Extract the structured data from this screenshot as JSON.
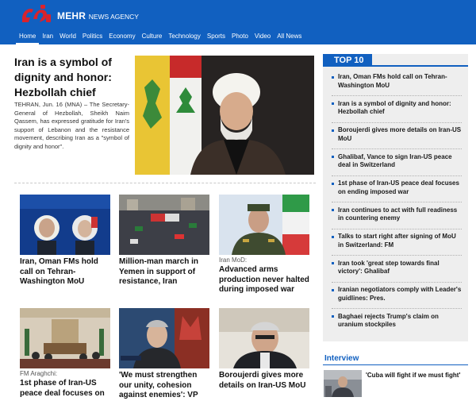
{
  "header": {
    "brand": "MEHR",
    "brand_sub": "NEWS AGENCY",
    "nav": [
      "Home",
      "Iran",
      "World",
      "Politics",
      "Economy",
      "Culture",
      "Technology",
      "Sports",
      "Photo",
      "Video",
      "All News"
    ],
    "active_nav": "Home"
  },
  "colors": {
    "brand_blue": "#1160c0",
    "logo_red": "#d9232d"
  },
  "lead": {
    "title": "Iran is a symbol of dignity and honor: Hezbollah chief",
    "text": "TEHRAN, Jun. 16 (MNA) – The Secretary-General of Hezbollah, Sheikh Naim Qassem, has expressed gratitude for Iran's support of Lebanon and the resistance movement, describing Iran as a \"symbol of dignity and honor\"."
  },
  "cards": [
    {
      "kicker": "",
      "title": "Iran, Oman FMs hold call on Tehran-Washington MoU"
    },
    {
      "kicker": "",
      "title": "Million-man march in Yemen in support of resistance, Iran"
    },
    {
      "kicker": "Iran MoD:",
      "title": "Advanced arms production never halted during imposed war"
    },
    {
      "kicker": "FM Araghchi:",
      "title": "1st phase of Iran-US peace deal focuses on"
    },
    {
      "kicker": "",
      "title": "'We must strengthen our unity, cohesion against enemies': VP"
    },
    {
      "kicker": "",
      "title": "Boroujerdi gives more details on Iran-US MoU"
    }
  ],
  "sidebar": {
    "top10_label": "TOP 10",
    "top10": [
      "Iran, Oman FMs hold call on Tehran-Washington MoU",
      "Iran is a symbol of dignity and honor: Hezbollah chief",
      "Boroujerdi gives more details on Iran-US MoU",
      "Ghalibaf, Vance to sign Iran-US peace deal in Switzerland",
      "1st phase of Iran-US peace deal focuses on ending imposed war",
      "Iran continues to act with full readiness in countering enemy",
      "Talks to start right after signing of MoU in Switzerland: FM",
      "Iran took 'great step towards final victory': Ghalibaf",
      "Iranian negotiators comply with Leader's guidlines: Pres.",
      "Baghaei rejects Trump's claim on uranium stockpiles"
    ],
    "interview_label": "Interview",
    "interview_title": "'Cuba will fight if we must fight'"
  }
}
